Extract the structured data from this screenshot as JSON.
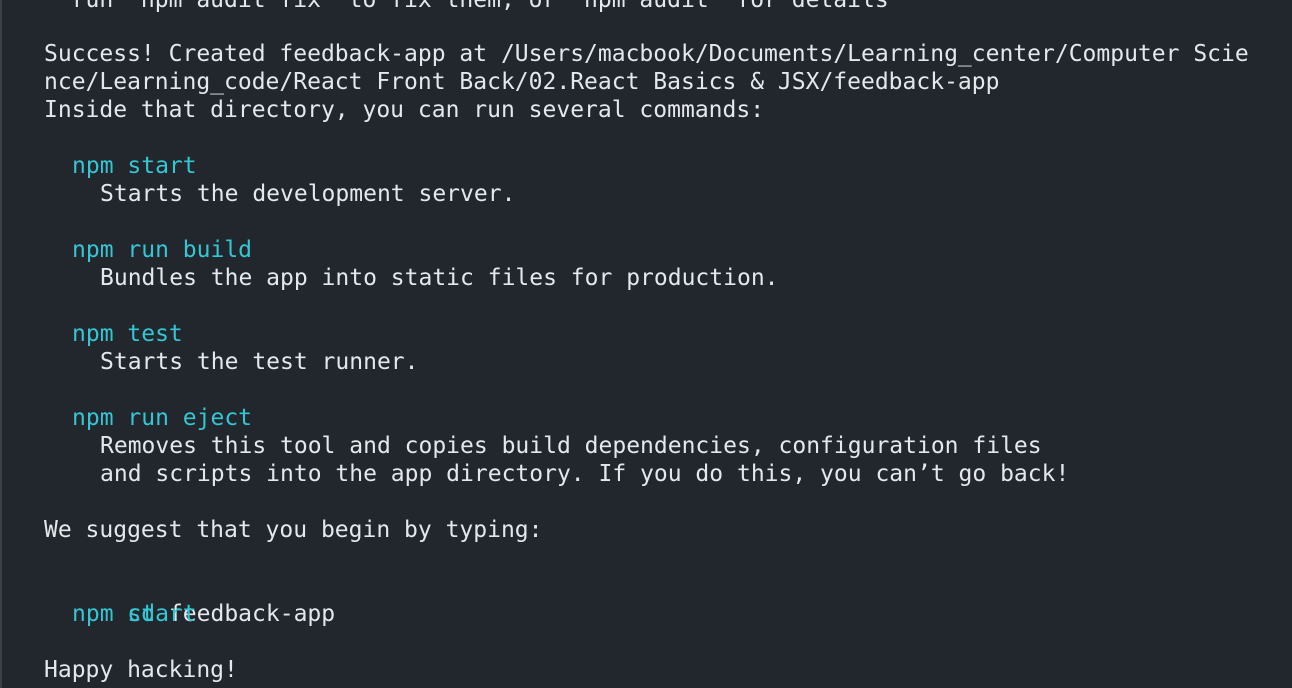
{
  "terminal": {
    "clipped_top_line": "  run `npm audit fix` to fix them, or `npm audit` for details",
    "success_line_1": "Success! Created feedback-app at /Users/macbook/Documents/Learning_center/Computer Scie",
    "success_line_2": "nce/Learning_code/React Front Back/02.React Basics & JSX/feedback-app",
    "inside_line": "Inside that directory, you can run several commands:",
    "commands": [
      {
        "command": "npm start",
        "description": [
          "Starts the development server."
        ]
      },
      {
        "command": "npm run build",
        "description": [
          "Bundles the app into static files for production."
        ]
      },
      {
        "command": "npm test",
        "description": [
          "Starts the test runner."
        ]
      },
      {
        "command": "npm run eject",
        "description": [
          "Removes this tool and copies build dependencies, configuration files",
          "and scripts into the app directory. If you do this, you can’t go back!"
        ]
      }
    ],
    "suggest_line": "We suggest that you begin by typing:",
    "suggest_cd_keyword": "cd",
    "suggest_cd_arg": " feedback-app",
    "suggest_start": "npm start",
    "happy_line": "Happy hacking!"
  },
  "colors": {
    "background": "#22272e",
    "text": "#e4e8ec",
    "command": "#35c5d3"
  }
}
